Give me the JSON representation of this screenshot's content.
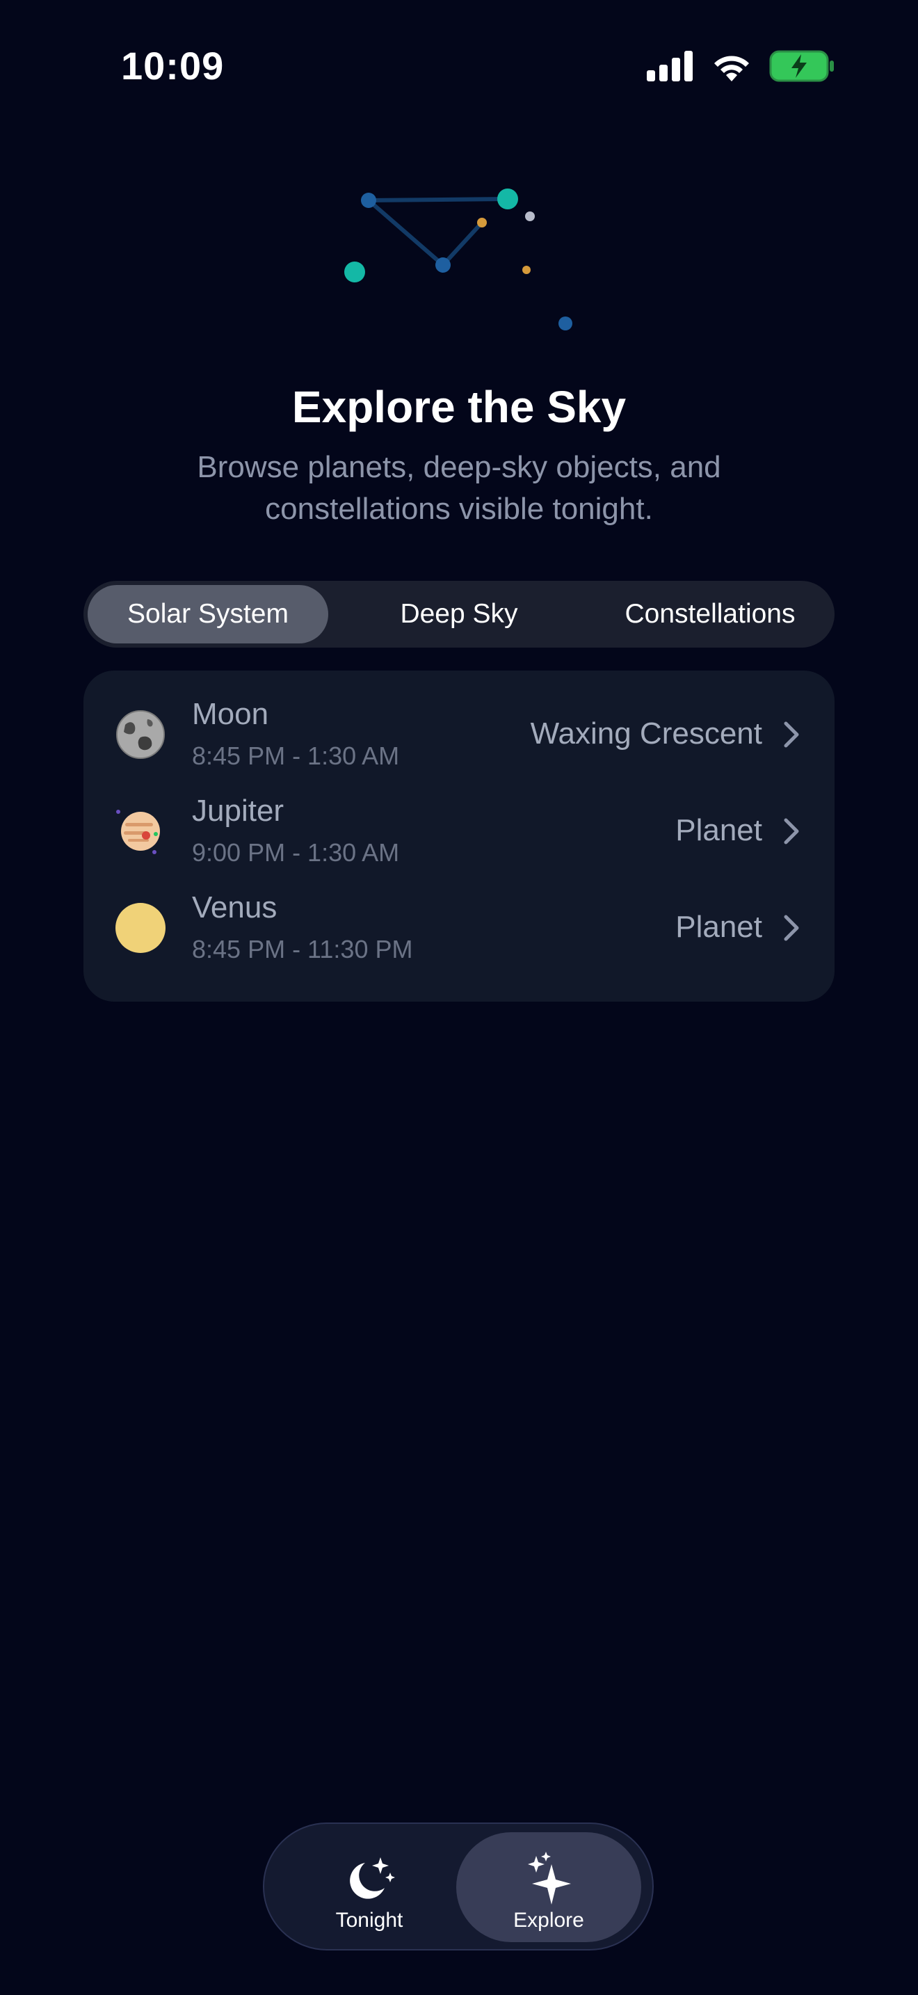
{
  "status_bar": {
    "time": "10:09",
    "icons": [
      "signal-icon",
      "wifi-icon",
      "battery-charging-icon"
    ],
    "battery_color": "#34c759"
  },
  "hero": {
    "icon": "constellation-icon",
    "title": "Explore the Sky",
    "subtitle": "Browse planets, deep-sky objects, and constellations visible tonight."
  },
  "segments": [
    {
      "label": "Solar System",
      "selected": true
    },
    {
      "label": "Deep Sky",
      "selected": false
    },
    {
      "label": "Constellations",
      "selected": false
    }
  ],
  "objects": [
    {
      "name": "Moon",
      "time": "8:45 PM - 1:30 AM",
      "type": "Waxing Crescent",
      "icon": "moon-icon"
    },
    {
      "name": "Jupiter",
      "time": "9:00 PM - 1:30 AM",
      "type": "Planet",
      "icon": "jupiter-icon"
    },
    {
      "name": "Venus",
      "time": "8:45 PM - 11:30 PM",
      "type": "Planet",
      "icon": "venus-icon"
    }
  ],
  "tab_bar": {
    "tabs": [
      {
        "label": "Tonight",
        "icon": "moon-stars-icon",
        "selected": false
      },
      {
        "label": "Explore",
        "icon": "sparkles-icon",
        "selected": true
      }
    ]
  },
  "colors": {
    "background": "#03061a",
    "accent_teal": "#14b8a6",
    "accent_blue": "#1e5fa0",
    "accent_orange": "#d69a3b"
  }
}
